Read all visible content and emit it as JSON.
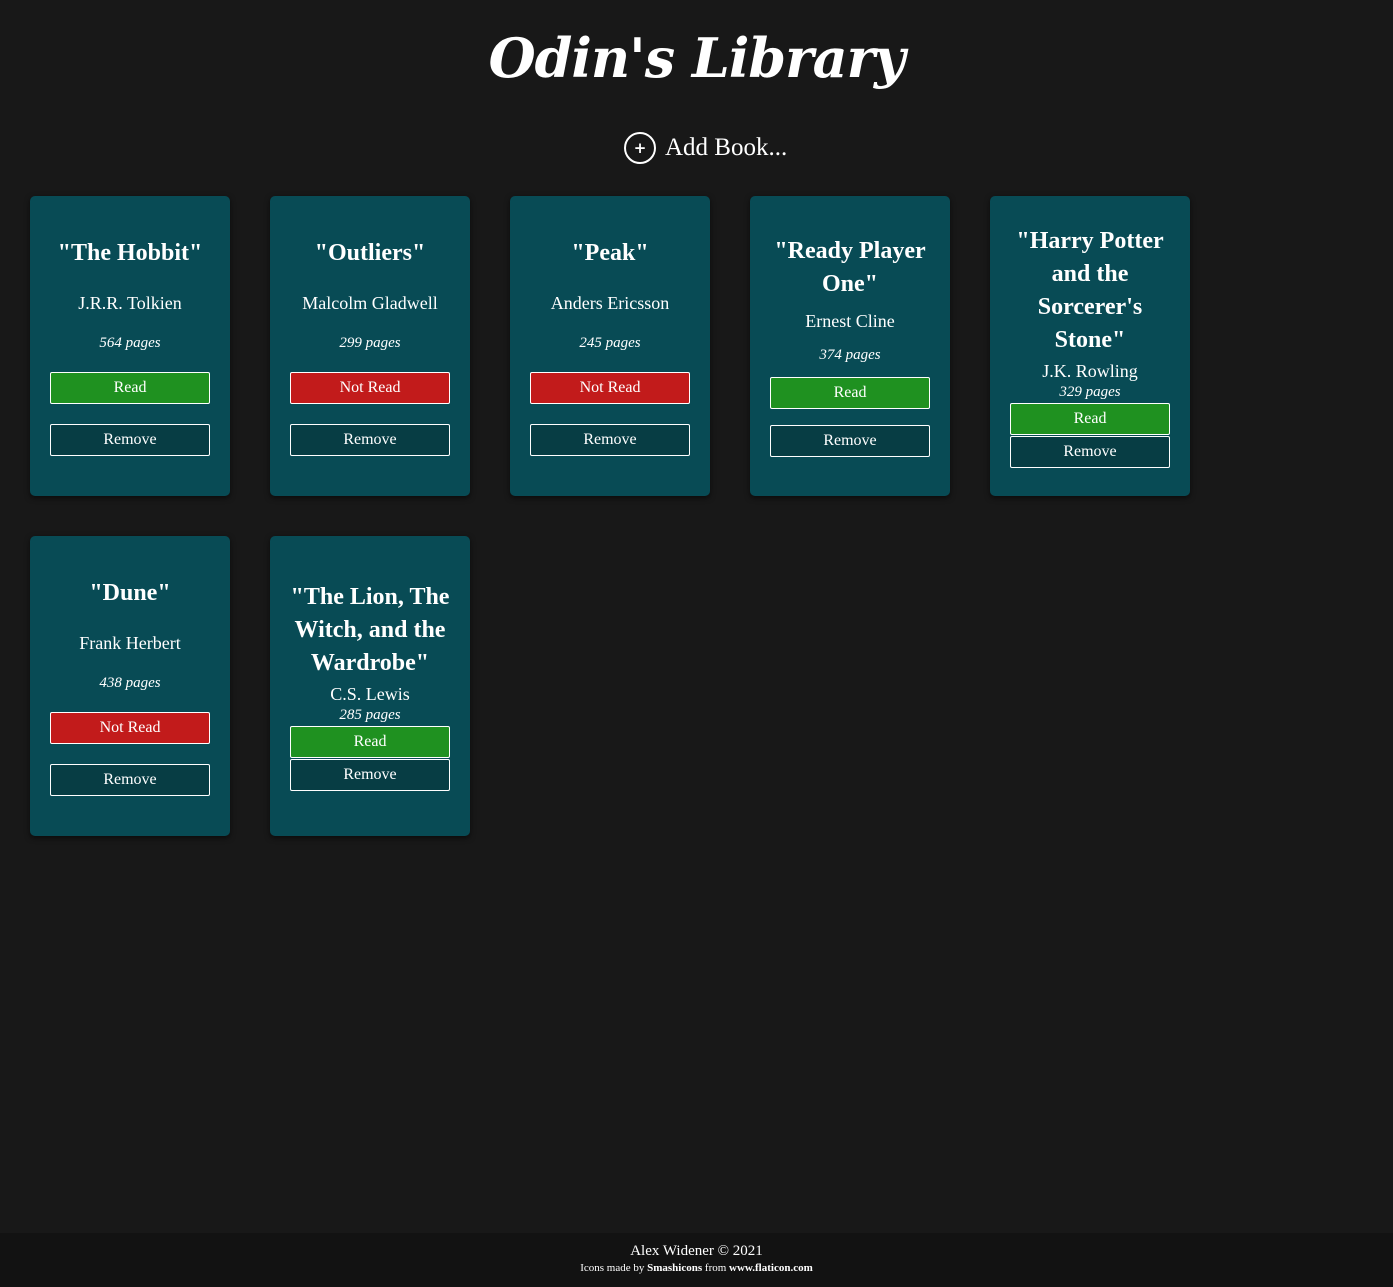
{
  "header": {
    "title": "Odin's Library"
  },
  "add_book": {
    "icon": "+",
    "label": "Add Book..."
  },
  "books": [
    {
      "title": "\"The Hobbit\"",
      "author": "J.R.R. Tolkien",
      "pages": "564 pages",
      "status": "Read",
      "remove": "Remove"
    },
    {
      "title": "\"Outliers\"",
      "author": "Malcolm Gladwell",
      "pages": "299 pages",
      "status": "Not Read",
      "remove": "Remove"
    },
    {
      "title": "\"Peak\"",
      "author": "Anders Ericsson",
      "pages": "245 pages",
      "status": "Not Read",
      "remove": "Remove"
    },
    {
      "title": "\"Ready Player One\"",
      "author": "Ernest Cline",
      "pages": "374 pages",
      "status": "Read",
      "remove": "Remove"
    },
    {
      "title": "\"Harry Potter and the Sorcerer's Stone\"",
      "author": "J.K. Rowling",
      "pages": "329 pages",
      "status": "Read",
      "remove": "Remove"
    },
    {
      "title": "\"Dune\"",
      "author": "Frank Herbert",
      "pages": "438 pages",
      "status": "Not Read",
      "remove": "Remove"
    },
    {
      "title": "\"The Lion, The Witch, and the Wardrobe\"",
      "author": "C.S. Lewis",
      "pages": "285 pages",
      "status": "Read",
      "remove": "Remove"
    }
  ],
  "footer": {
    "credit": "Alex Widener © 2021",
    "icons_prefix": "Icons made by",
    "icons_author": "Smashicons",
    "icons_from": "from",
    "icons_site": "www.flaticon.com"
  },
  "colors": {
    "background": "#181818",
    "card": "#084b55",
    "read": "#1f9120",
    "not_read": "#c21b1b",
    "remove": "#073d44"
  }
}
